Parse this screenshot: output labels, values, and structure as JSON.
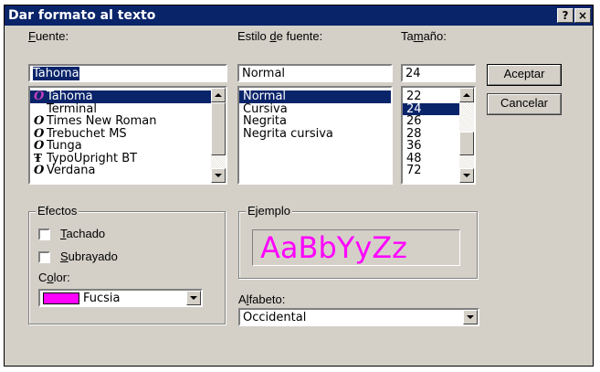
{
  "window": {
    "title": "Dar formato al texto",
    "help_btn": "?",
    "close_btn": "×"
  },
  "font": {
    "label_pre": "",
    "label_u": "F",
    "label_post": "uente:",
    "value": "Tahoma",
    "items": [
      {
        "icon": "opentype-icon",
        "glyph": "O",
        "name": "Tahoma",
        "selected": true
      },
      {
        "icon": "none",
        "glyph": "",
        "name": "Terminal",
        "selected": false
      },
      {
        "icon": "opentype-icon",
        "glyph": "O",
        "name": "Times New Roman",
        "selected": false
      },
      {
        "icon": "opentype-icon",
        "glyph": "O",
        "name": "Trebuchet MS",
        "selected": false
      },
      {
        "icon": "opentype-icon",
        "glyph": "O",
        "name": "Tunga",
        "selected": false
      },
      {
        "icon": "truetype-icon",
        "glyph": "Ŧ",
        "name": "TypoUpright BT",
        "selected": false
      },
      {
        "icon": "opentype-icon",
        "glyph": "O",
        "name": "Verdana",
        "selected": false
      }
    ]
  },
  "style": {
    "label_pre": "Estilo ",
    "label_u": "d",
    "label_post": "e fuente:",
    "value": "Normal",
    "items": [
      {
        "name": "Normal",
        "selected": true
      },
      {
        "name": "Cursiva",
        "selected": false
      },
      {
        "name": "Negrita",
        "selected": false
      },
      {
        "name": "Negrita cursiva",
        "selected": false
      }
    ]
  },
  "size": {
    "label_pre": "Ta",
    "label_u": "m",
    "label_post": "año:",
    "value": "24",
    "items": [
      {
        "name": "22",
        "selected": false
      },
      {
        "name": "24",
        "selected": true
      },
      {
        "name": "26",
        "selected": false
      },
      {
        "name": "28",
        "selected": false
      },
      {
        "name": "36",
        "selected": false
      },
      {
        "name": "48",
        "selected": false
      },
      {
        "name": "72",
        "selected": false
      }
    ]
  },
  "buttons": {
    "ok": "Aceptar",
    "cancel": "Cancelar"
  },
  "effects": {
    "title": "Efectos",
    "strike": {
      "u": "T",
      "rest": "achado",
      "checked": false
    },
    "underline": {
      "u": "S",
      "rest": "ubrayado",
      "checked": false
    },
    "color_label_pre": "C",
    "color_label_u": "o",
    "color_label_post": "lor:",
    "color_value": "Fucsia",
    "color_hex": "#ff00ff"
  },
  "sample": {
    "title": "Ejemplo",
    "text": "AaBbYyZz",
    "color": "#ff00ff"
  },
  "script": {
    "label_pre": "A",
    "label_u": "l",
    "label_post": "fabeto:",
    "value": "Occidental"
  },
  "colors": {
    "titlebar": "#0a246a",
    "face": "#d4d0c8",
    "selection": "#0a246a"
  }
}
